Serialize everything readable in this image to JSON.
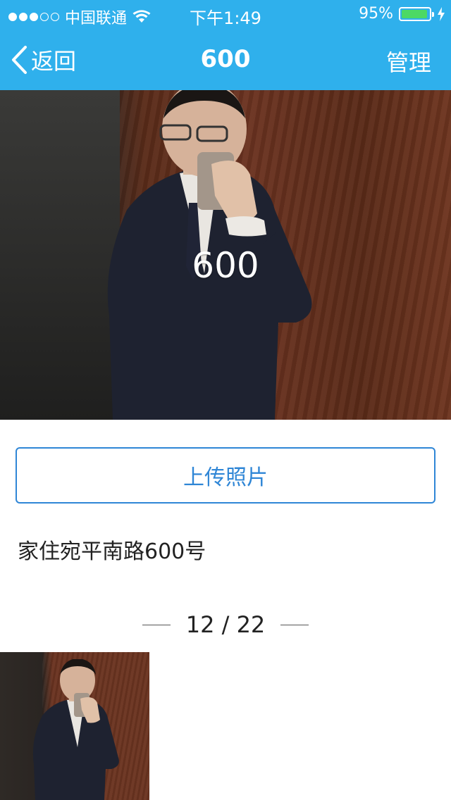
{
  "status_bar": {
    "carrier": "中国联通",
    "time": "下午1:49",
    "battery_percent": "95%",
    "battery_level": 0.95,
    "signal_bars_filled": 3,
    "signal_bars_total": 5,
    "icons": [
      "wifi-icon",
      "battery-icon",
      "charging-bolt-icon"
    ]
  },
  "nav": {
    "back_label": "返回",
    "title": "600",
    "right_label": "管理",
    "icons": [
      "chevron-left-icon"
    ]
  },
  "photo": {
    "caption": "600"
  },
  "actions": {
    "upload_label": "上传照片"
  },
  "detail": {
    "address": "家住宛平南路600号"
  },
  "pager": {
    "text": "12 / 22"
  },
  "colors": {
    "nav_blue": "#2fb0ec",
    "button_blue": "#2f86d6",
    "battery_green": "#4cd964"
  }
}
